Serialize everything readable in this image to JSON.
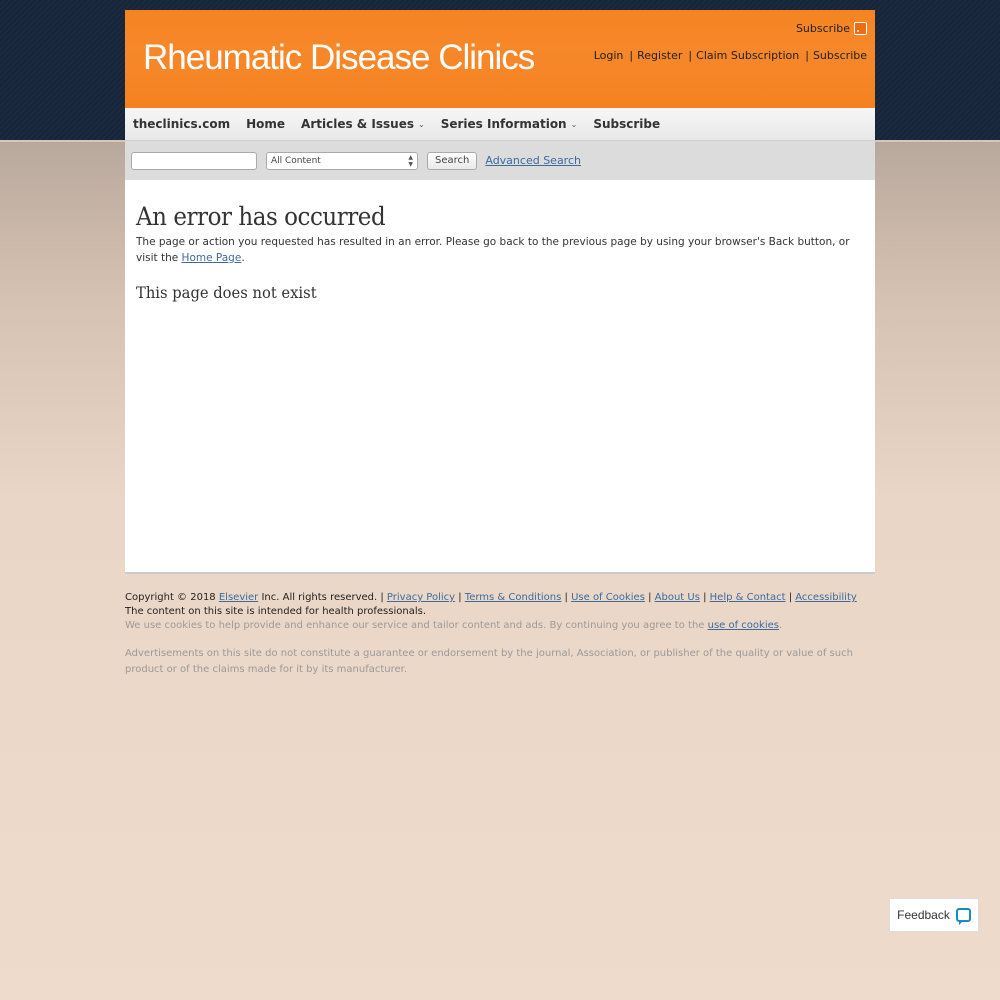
{
  "header": {
    "logo": "Rheumatic Disease Clinics",
    "rss_label": "Subscribe",
    "user_links": [
      "Login",
      "Register",
      "Claim Subscription",
      "Subscribe"
    ]
  },
  "nav": {
    "items": [
      {
        "label": "theclinics.com",
        "dropdown": false
      },
      {
        "label": "Home",
        "dropdown": false
      },
      {
        "label": "Articles & Issues",
        "dropdown": true
      },
      {
        "label": "Series Information",
        "dropdown": true
      },
      {
        "label": "Subscribe",
        "dropdown": false
      }
    ]
  },
  "search": {
    "input_value": "",
    "select_value": "All Content",
    "button_label": "Search",
    "advanced_label": "Advanced Search"
  },
  "main": {
    "title": "An error has occurred",
    "message": "The page or action you requested has resulted in an error. Please go back to the previous page by using your browser's Back button, or visit the ",
    "home_link": "Home Page",
    "message_end": ".",
    "subtitle": "This page does not exist"
  },
  "footer": {
    "copyright_pre": "Copyright © 2018 ",
    "elsevier": "Elsevier",
    "copyright_post": " Inc. All rights reserved. | ",
    "links": [
      "Privacy Policy",
      "Terms & Conditions",
      "Use of Cookies",
      "About Us",
      "Help & Contact",
      "Accessibility"
    ],
    "health_note": "The content on this site is intended for health professionals.",
    "cookie_text": "We use cookies to help provide and enhance our service and tailor content and ads. By continuing you agree to the ",
    "cookie_link": "use of cookies",
    "cookie_end": ".",
    "ads_text": "Advertisements on this site do not constitute a guarantee or endorsement by the journal, Association, or publisher of the quality or value of such product or of the claims made for it by its manufacturer."
  },
  "feedback": {
    "label": "Feedback"
  },
  "colors": {
    "brand_orange": "#f6841f",
    "link": "#3e6a9c",
    "dark_band": "#17253a"
  }
}
